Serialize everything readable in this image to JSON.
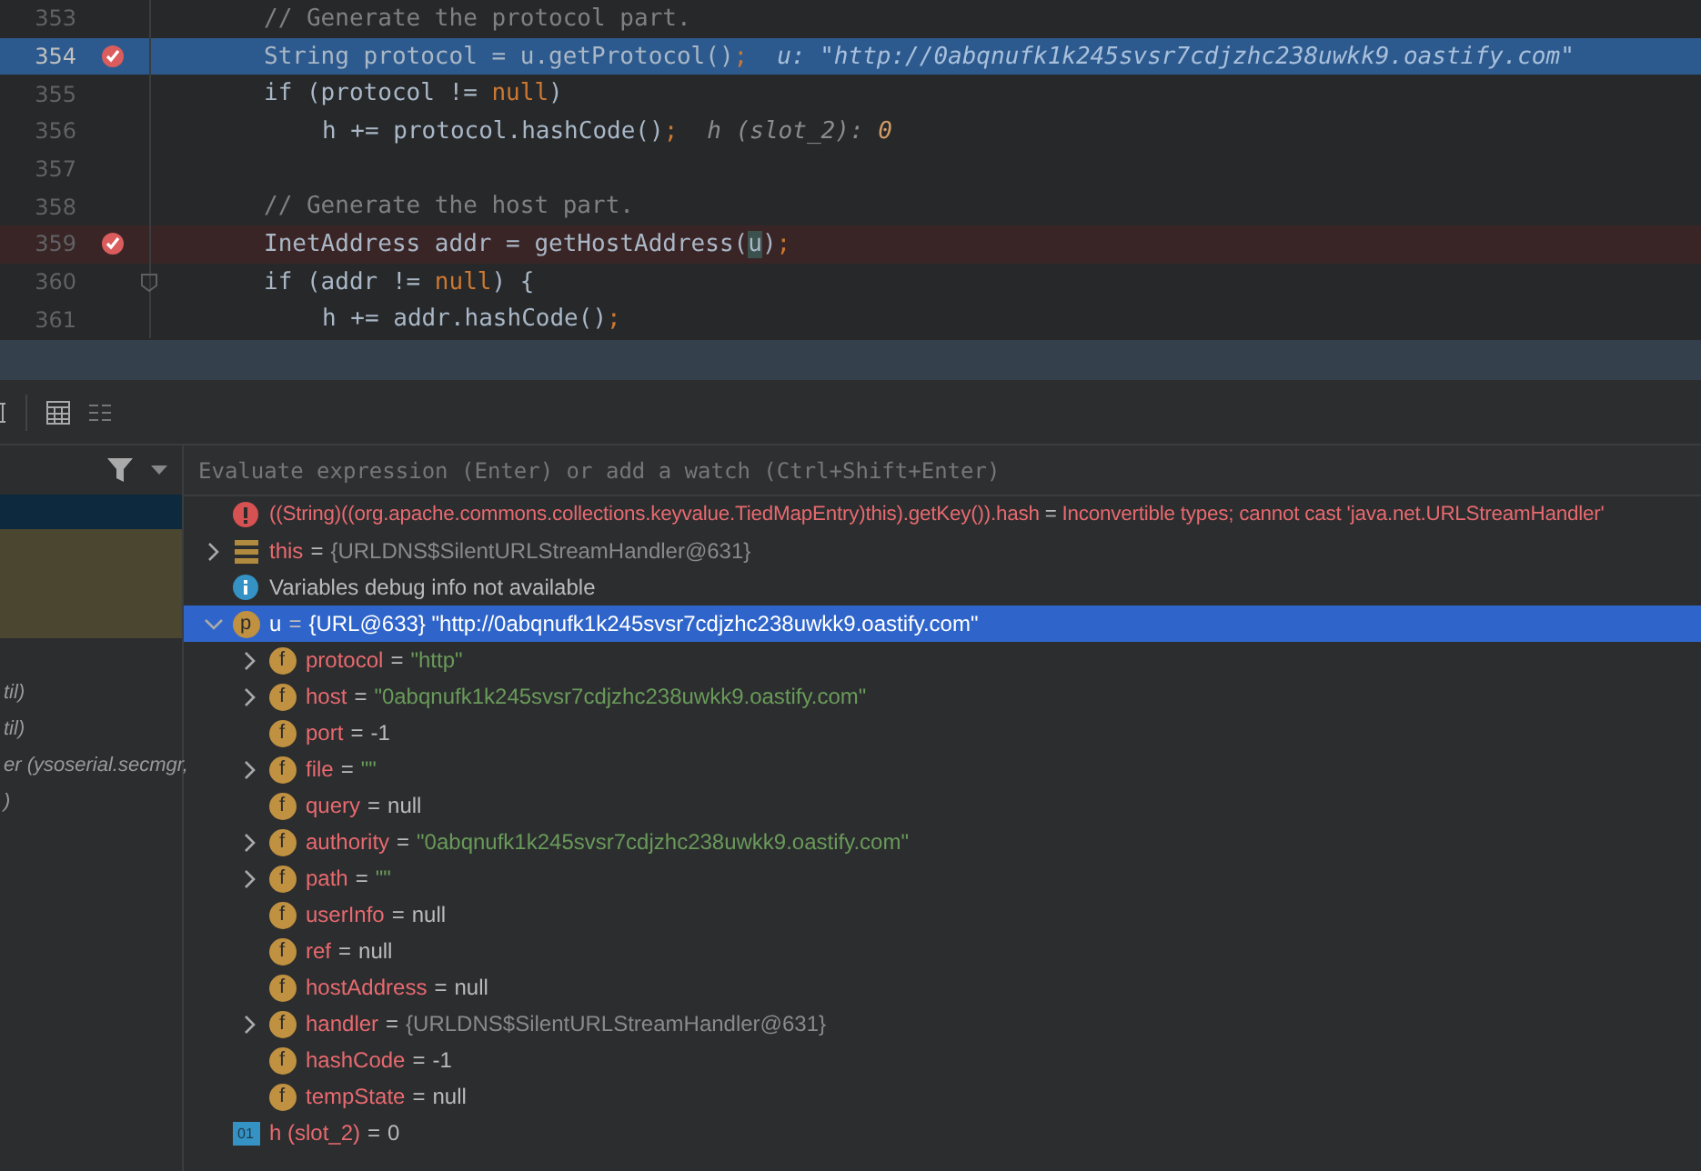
{
  "editor": {
    "lines": [
      {
        "number": "353",
        "kind": "block",
        "breakpoint": false,
        "current": false,
        "fold": false,
        "tokens": [
          {
            "kind": "comment",
            "text": "// Generate the protocol part."
          }
        ]
      },
      {
        "number": "354",
        "kind": "block",
        "breakpoint": true,
        "current": true,
        "fold": false,
        "tokens": [
          {
            "kind": "plain",
            "text": "String protocol = u.getProtocol()"
          },
          {
            "kind": "kw",
            "text": ";"
          },
          {
            "kind": "hint",
            "text": "u: \"http://0abqnufk1k245svsr7cdjzhc238uwkk9.oastify.com\""
          }
        ]
      },
      {
        "number": "355",
        "kind": "block",
        "breakpoint": false,
        "current": false,
        "fold": false,
        "tokens": [
          {
            "kind": "plain",
            "text": "if (protocol != "
          },
          {
            "kind": "kw",
            "text": "null"
          },
          {
            "kind": "plain",
            "text": ")"
          }
        ]
      },
      {
        "number": "356",
        "kind": "nested",
        "breakpoint": false,
        "current": false,
        "fold": false,
        "tokens": [
          {
            "kind": "plain",
            "text": "h += protocol.hashCode()"
          },
          {
            "kind": "kw",
            "text": ";"
          },
          {
            "kind": "hint",
            "text": "h (slot_2): "
          },
          {
            "kind": "hintnum",
            "text": "0"
          }
        ]
      },
      {
        "number": "357",
        "kind": "block",
        "breakpoint": false,
        "current": false,
        "fold": false
      },
      {
        "number": "358",
        "kind": "block",
        "breakpoint": false,
        "current": false,
        "fold": false,
        "tokens": [
          {
            "kind": "comment",
            "text": "// Generate the host part."
          }
        ]
      },
      {
        "number": "359",
        "kind": "block",
        "breakpoint": true,
        "current": false,
        "fold": false,
        "tokens": [
          {
            "kind": "plain",
            "text": "InetAddress addr = getHostAddress("
          },
          {
            "kind": "match",
            "text": "u"
          },
          {
            "kind": "plain",
            "text": ")"
          },
          {
            "kind": "kw",
            "text": ";"
          }
        ]
      },
      {
        "number": "360",
        "kind": "block",
        "breakpoint": false,
        "current": false,
        "fold": true,
        "tokens": [
          {
            "kind": "plain",
            "text": "if (addr != "
          },
          {
            "kind": "kw",
            "text": "null"
          },
          {
            "kind": "plain",
            "text": ") {"
          }
        ]
      },
      {
        "number": "361",
        "kind": "nested",
        "breakpoint": false,
        "current": false,
        "fold": false,
        "tokens": [
          {
            "kind": "plain",
            "text": "h += addr.hashCode()"
          },
          {
            "kind": "kw",
            "text": ";"
          }
        ]
      }
    ]
  },
  "frames": [
    {
      "label": "til)"
    },
    {
      "label": "til)"
    },
    {
      "label": "er (ysoserial.secmgr,"
    },
    {
      "label": ")"
    }
  ],
  "watch": {
    "placeholder": "Evaluate expression (Enter) or add a watch (Ctrl+Shift+Enter)"
  },
  "variables": [
    {
      "kind": "error",
      "name": "((String)((org.apache.commons.collections.keyvalue.TiedMapEntry)this).getKey()).hash",
      "equals": "=",
      "value": {
        "kind": "error",
        "text": "Inconvertible types; cannot cast 'java.net.URLStreamHandler'"
      },
      "selected": false
    },
    {
      "kind": "object",
      "name": "this",
      "equals": "=",
      "value": {
        "kind": "object",
        "text": "{URLDNS$SilentURLStreamHandler@631}"
      },
      "expanded": false,
      "selected": false
    },
    {
      "kind": "info",
      "text": "Variables debug info not available"
    },
    {
      "kind": "param",
      "badge": "p",
      "name": "u",
      "equals": "=",
      "value": {
        "kind": "plain",
        "text": "{URL@633} \"http://0abqnufk1k245svsr7cdjzhc238uwkk9.oastify.com\""
      },
      "expanded": true,
      "selected": true,
      "children": [
        {
          "kind": "field",
          "badge": "f",
          "name": "protocol",
          "equals": "=",
          "value": {
            "kind": "string",
            "text": "\"http\""
          },
          "expanded": false,
          "selected": false
        },
        {
          "kind": "field",
          "badge": "f",
          "name": "host",
          "equals": "=",
          "value": {
            "kind": "string",
            "text": "\"0abqnufk1k245svsr7cdjzhc238uwkk9.oastify.com\""
          },
          "expanded": false,
          "selected": false
        },
        {
          "kind": "field",
          "badge": "f",
          "name": "port",
          "equals": "=",
          "value": {
            "kind": "plain",
            "text": "-1"
          },
          "selected": false
        },
        {
          "kind": "field",
          "badge": "f",
          "name": "file",
          "equals": "=",
          "value": {
            "kind": "string",
            "text": "\"\""
          },
          "expanded": false,
          "selected": false
        },
        {
          "kind": "field",
          "badge": "f",
          "name": "query",
          "equals": "=",
          "value": {
            "kind": "plain",
            "text": "null"
          },
          "selected": false
        },
        {
          "kind": "field",
          "badge": "f",
          "name": "authority",
          "equals": "=",
          "value": {
            "kind": "string",
            "text": "\"0abqnufk1k245svsr7cdjzhc238uwkk9.oastify.com\""
          },
          "expanded": false,
          "selected": false
        },
        {
          "kind": "field",
          "badge": "f",
          "name": "path",
          "equals": "=",
          "value": {
            "kind": "string",
            "text": "\"\""
          },
          "expanded": false,
          "selected": false
        },
        {
          "kind": "field",
          "badge": "f",
          "name": "userInfo",
          "equals": "=",
          "value": {
            "kind": "plain",
            "text": "null"
          },
          "selected": false
        },
        {
          "kind": "field",
          "badge": "f",
          "name": "ref",
          "equals": "=",
          "value": {
            "kind": "plain",
            "text": "null"
          },
          "selected": false
        },
        {
          "kind": "field",
          "badge": "f",
          "name": "hostAddress",
          "equals": "=",
          "value": {
            "kind": "plain",
            "text": "null"
          },
          "selected": false
        },
        {
          "kind": "field",
          "badge": "f",
          "name": "handler",
          "equals": "=",
          "value": {
            "kind": "object",
            "text": "{URLDNS$SilentURLStreamHandler@631}"
          },
          "expanded": false,
          "selected": false
        },
        {
          "kind": "field",
          "badge": "f",
          "name": "hashCode",
          "equals": "=",
          "value": {
            "kind": "plain",
            "text": "-1"
          },
          "selected": false
        },
        {
          "kind": "field",
          "badge": "f",
          "name": "tempState",
          "equals": "=",
          "value": {
            "kind": "plain",
            "text": "null"
          },
          "selected": false
        }
      ]
    },
    {
      "kind": "local",
      "badge": "01",
      "name": "h (slot_2)",
      "equals": "=",
      "value": {
        "kind": "plain",
        "text": "0"
      },
      "selected": false
    }
  ]
}
